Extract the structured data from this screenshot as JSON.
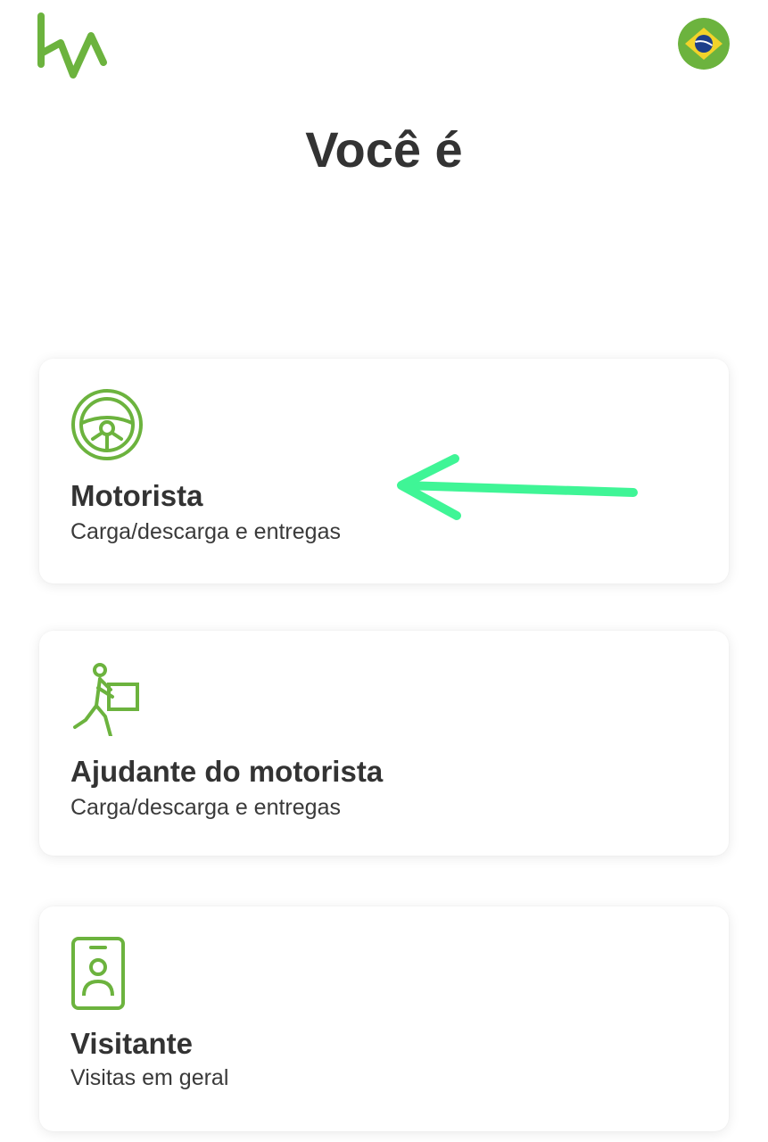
{
  "header": {
    "logo_icon": "ka-logo-icon",
    "language_icon": "brazil-flag-icon"
  },
  "page_title": "Você é",
  "options": [
    {
      "title": "Motorista",
      "subtitle": "Carga/descarga e entregas",
      "icon": "steering-wheel-icon"
    },
    {
      "title": "Ajudante do motorista",
      "subtitle": "Carga/descarga e entregas",
      "icon": "person-carrying-box-icon"
    },
    {
      "title": "Visitante",
      "subtitle": "Visitas em geral",
      "icon": "id-badge-icon"
    }
  ],
  "colors": {
    "brand_green": "#6cb33e",
    "annotation_arrow": "#3ff596",
    "text_dark": "#333333",
    "card_background": "#ffffff"
  },
  "annotation": {
    "icon": "arrow-left-icon",
    "points_to": "Motorista"
  }
}
